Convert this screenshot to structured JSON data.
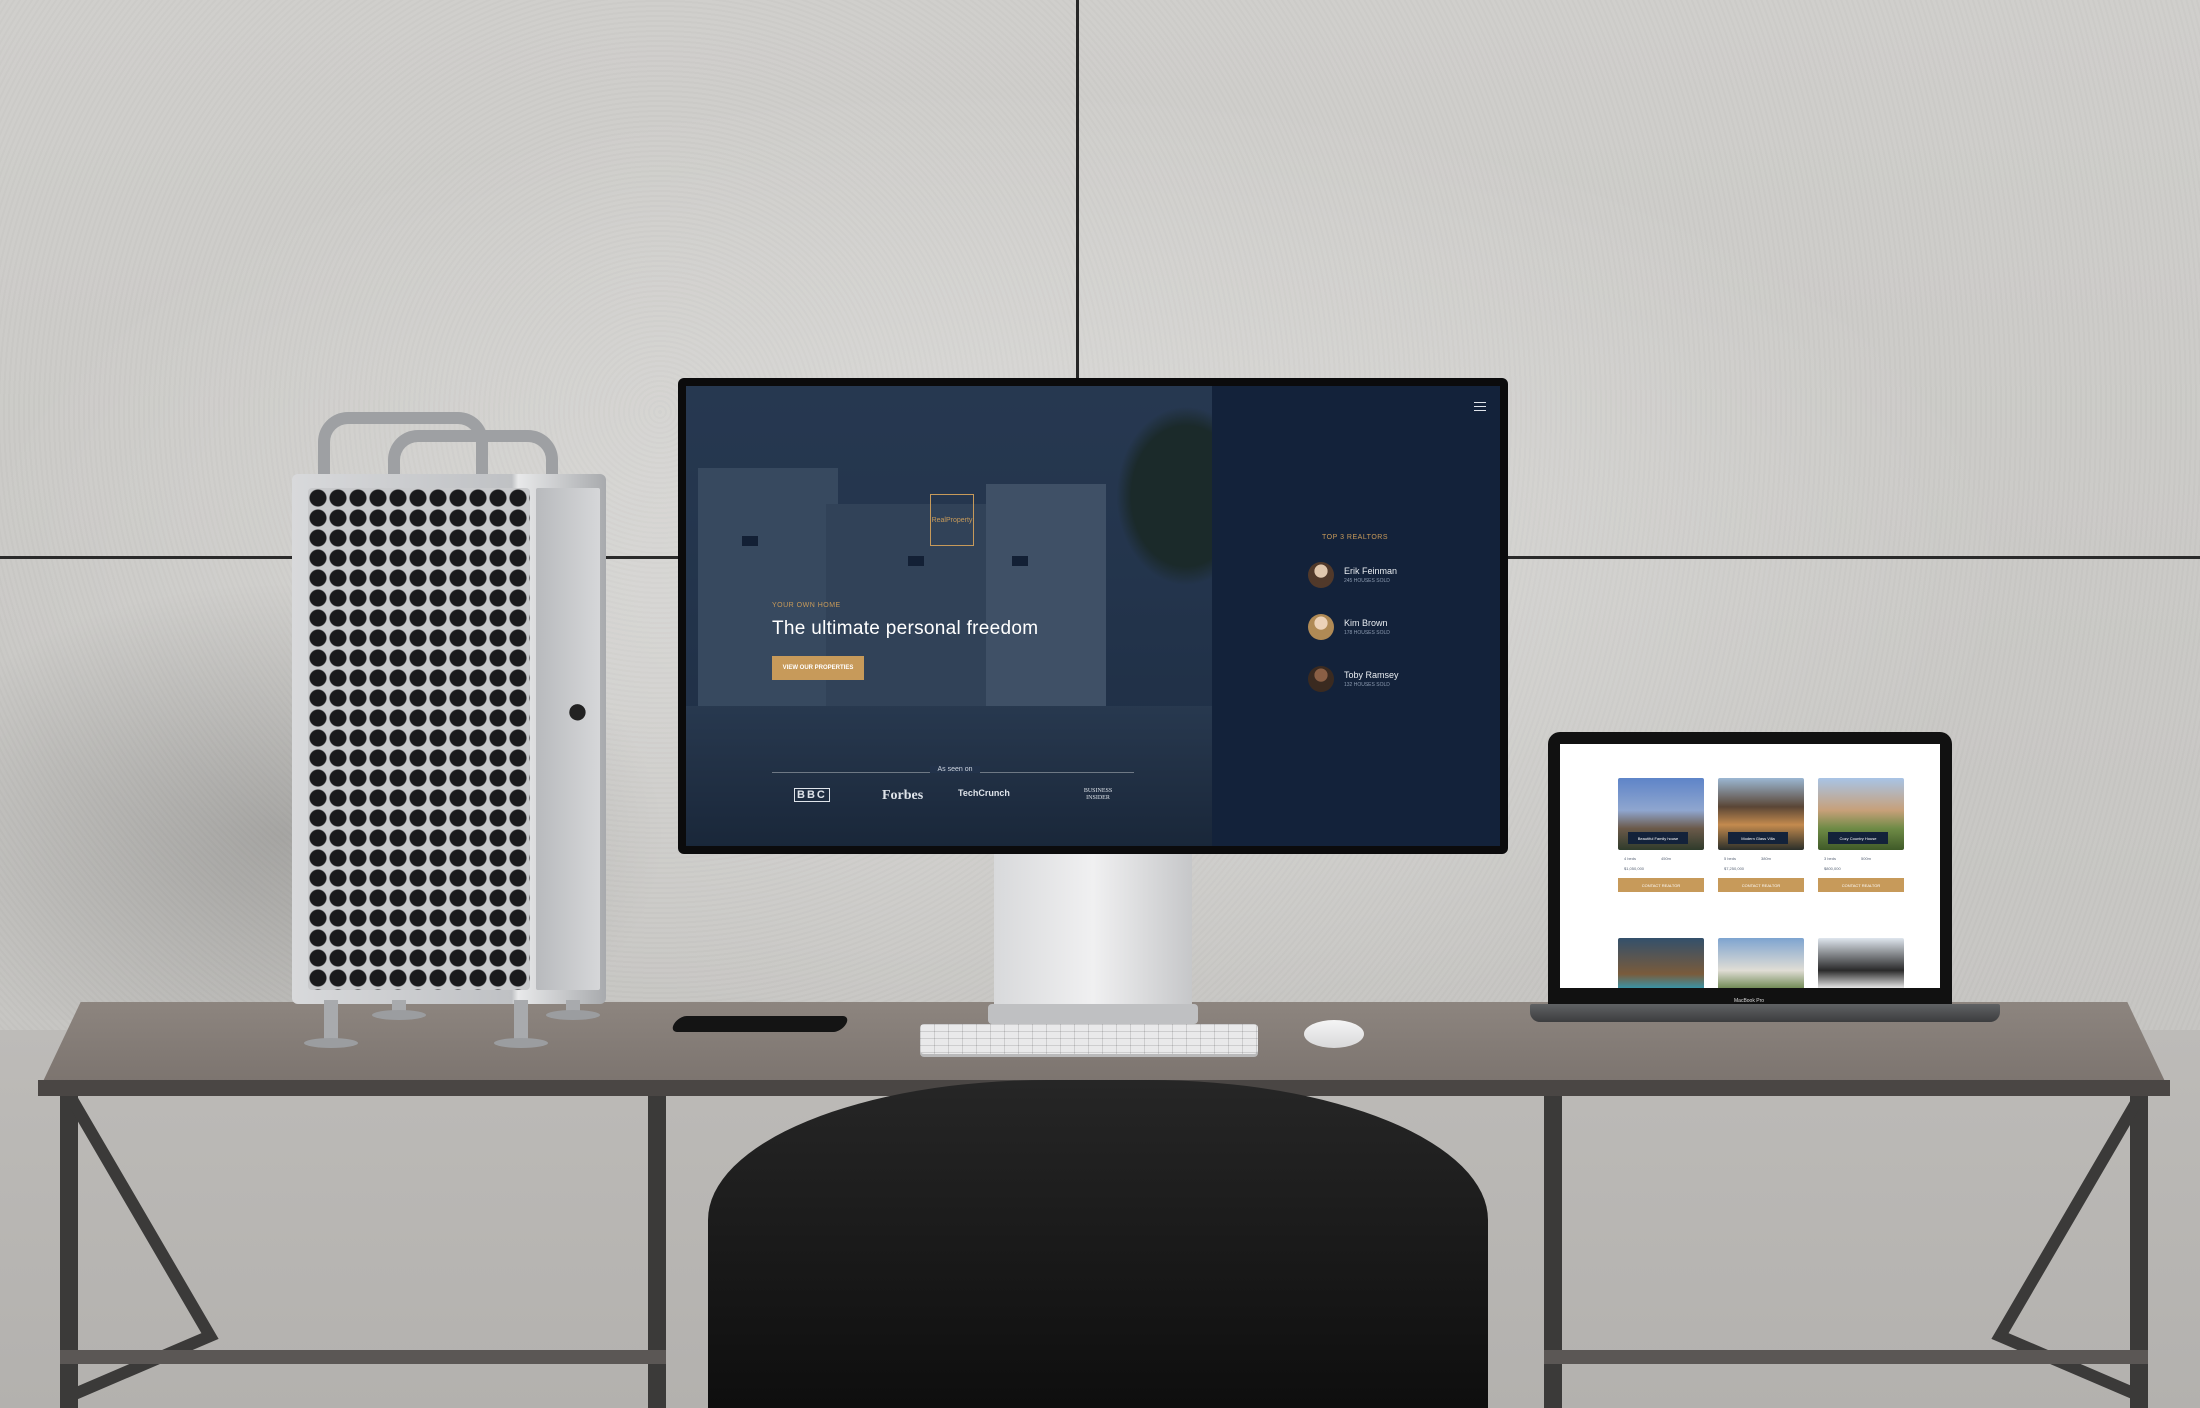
{
  "site": {
    "logo": "RealProperty",
    "eyebrow": "YOUR OWN HOME",
    "hero_title": "The ultimate personal freedom",
    "cta_label": "VIEW OUR PROPERTIES",
    "as_seen_on": "As seen on",
    "press": [
      "BBC",
      "Forbes",
      "TechCrunch",
      "BUSINESS INSIDER"
    ],
    "menu_icon": "hamburger-icon",
    "realtors_title": "TOP 3 REALTORS",
    "realtors": [
      {
        "name": "Erik Feinman",
        "sold": "245 HOUSES SOLD"
      },
      {
        "name": "Kim Brown",
        "sold": "178 HOUSES SOLD"
      },
      {
        "name": "Toby Ramsey",
        "sold": "132 HOUSES SOLD"
      }
    ]
  },
  "laptop": {
    "label": "MacBook Pro",
    "cards": [
      {
        "name": "Beautiful Family house",
        "beds": "4 beds",
        "area": "450m",
        "price": "$1,050,000",
        "contact": "CONTACT REALTOR"
      },
      {
        "name": "Modern Glass Villa",
        "beds": "5 beds",
        "area": "380m",
        "price": "$7,250,000",
        "contact": "CONTACT REALTOR"
      },
      {
        "name": "Cozy Country House",
        "beds": "3 beds",
        "area": "500m",
        "price": "$800,000",
        "contact": "CONTACT REALTOR"
      }
    ]
  },
  "colors": {
    "accent_gold": "#c79a5a",
    "navy": "#13223a"
  }
}
